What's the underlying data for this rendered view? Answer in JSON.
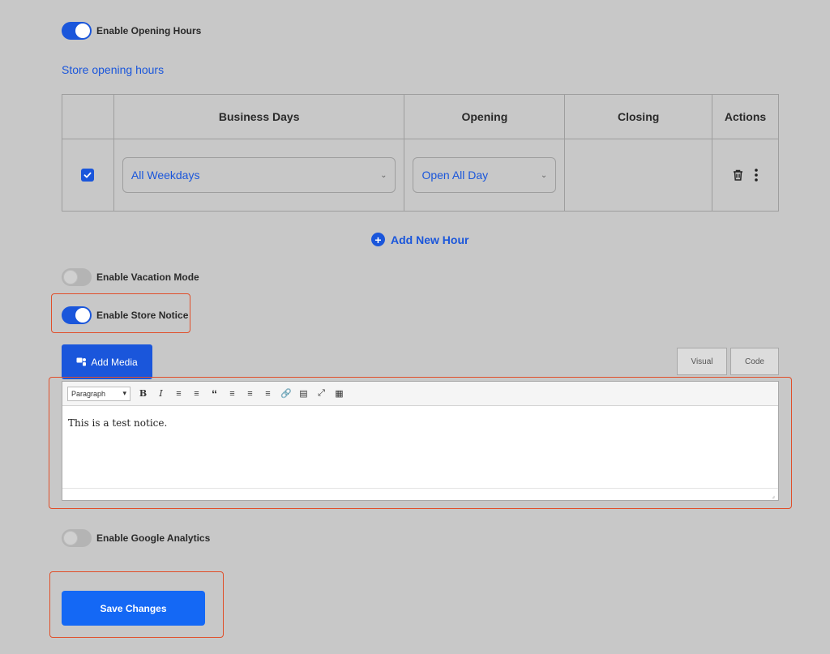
{
  "opening_hours_toggle": {
    "label": "Enable Opening Hours",
    "on": true
  },
  "store_hours": {
    "title": "Store opening hours",
    "columns": [
      "",
      "Business Days",
      "Opening",
      "Closing",
      "Actions"
    ],
    "rows": [
      {
        "checked": true,
        "business_days": "All Weekdays",
        "opening": "Open All Day",
        "closing": ""
      }
    ],
    "add_label": "Add New Hour"
  },
  "vacation_toggle": {
    "label": "Enable Vacation Mode",
    "on": false
  },
  "store_notice_toggle": {
    "label": "Enable Store Notice",
    "on": true
  },
  "editor": {
    "add_media_label": "Add Media",
    "tabs": [
      "Visual",
      "Code"
    ],
    "format_select": "Paragraph",
    "toolbar_icons": [
      "bold-icon",
      "italic-icon",
      "bullet-list-icon",
      "numbered-list-icon",
      "blockquote-icon",
      "align-left-icon",
      "align-center-icon",
      "align-right-icon",
      "link-icon",
      "read-more-icon",
      "fullscreen-icon",
      "toolbar-toggle-icon"
    ],
    "content": "This is a test notice."
  },
  "analytics_toggle": {
    "label": "Enable Google Analytics",
    "on": false
  },
  "save_label": "Save Changes",
  "colors": {
    "accent": "#1a56db",
    "highlight": "#e04f2a",
    "save": "#1468f5"
  }
}
